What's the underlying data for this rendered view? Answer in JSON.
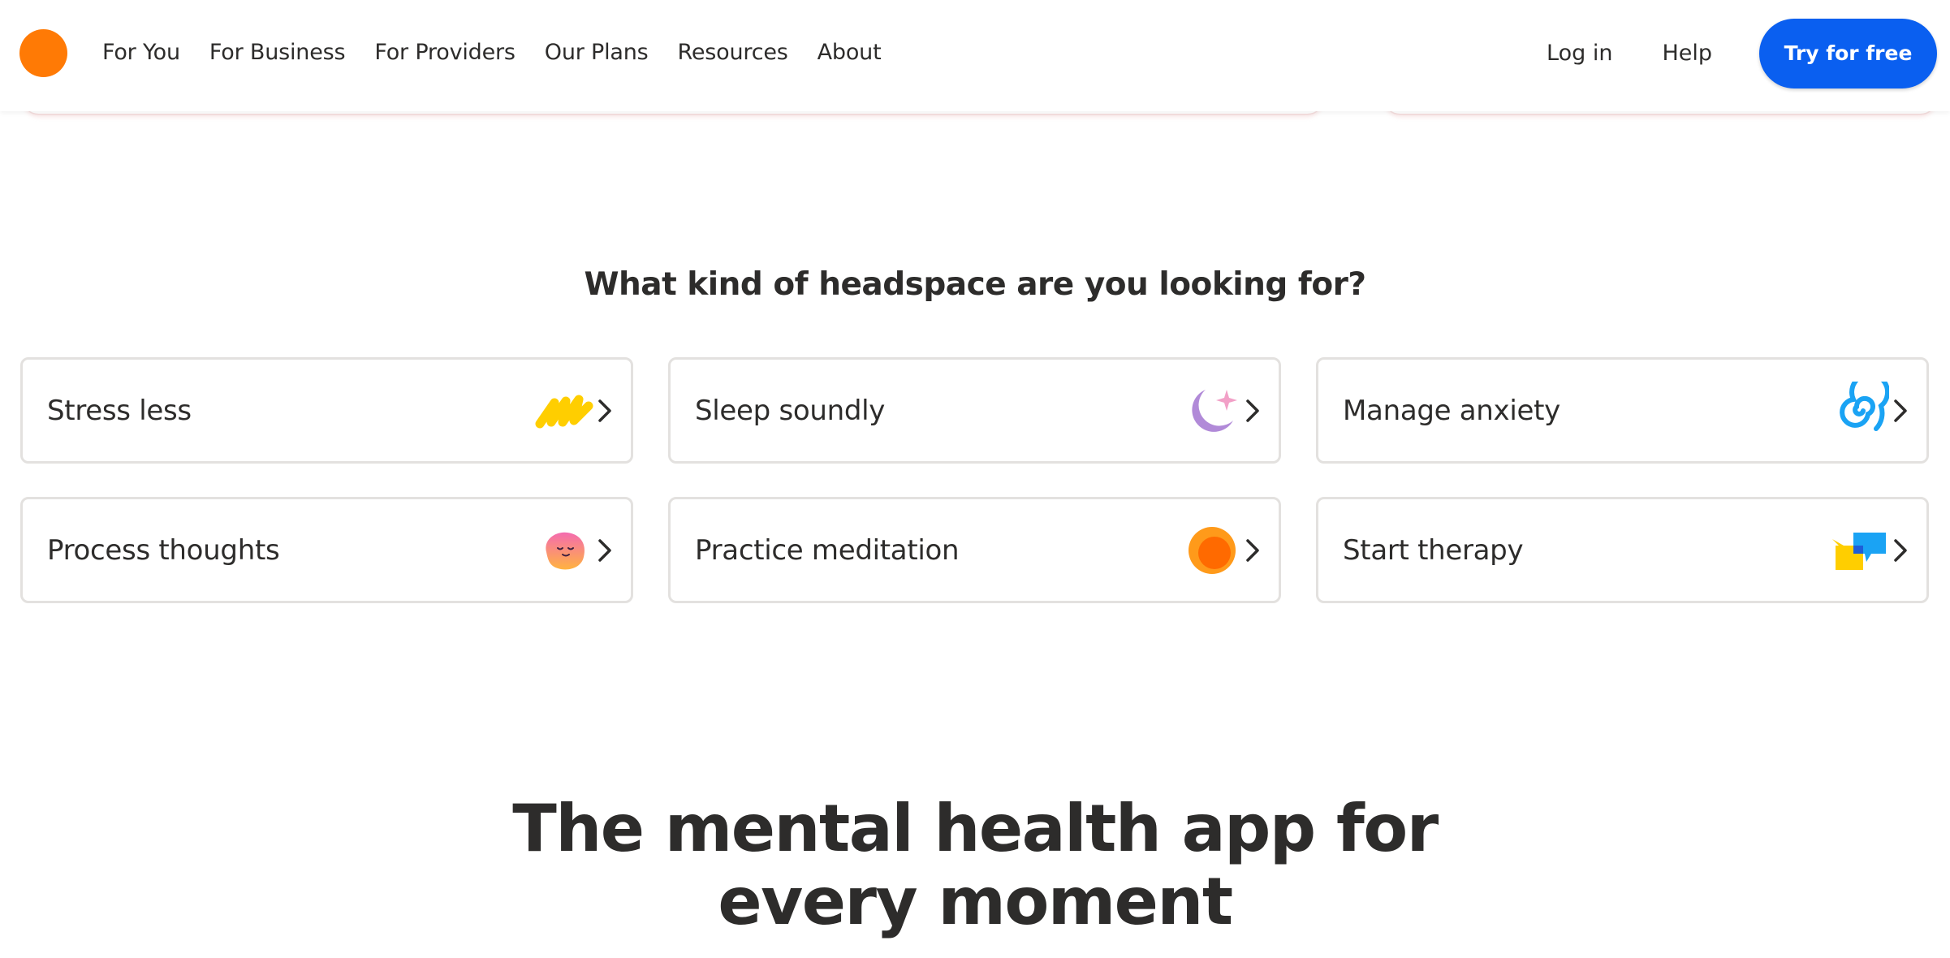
{
  "header": {
    "nav": [
      {
        "label": "For You"
      },
      {
        "label": "For Business"
      },
      {
        "label": "For Providers"
      },
      {
        "label": "Our Plans"
      },
      {
        "label": "Resources"
      },
      {
        "label": "About"
      }
    ],
    "login_label": "Log in",
    "help_label": "Help",
    "cta_label": "Try for free"
  },
  "section": {
    "heading": "What kind of headspace are you looking for?",
    "cards": [
      {
        "label": "Stress less",
        "icon": "yellow-squiggle-icon"
      },
      {
        "label": "Sleep soundly",
        "icon": "moon-star-icon"
      },
      {
        "label": "Manage anxiety",
        "icon": "blue-spiral-icon"
      },
      {
        "label": "Process thoughts",
        "icon": "smiling-blob-icon"
      },
      {
        "label": "Practice meditation",
        "icon": "orange-dot-icon"
      },
      {
        "label": "Start therapy",
        "icon": "speech-bubbles-icon"
      }
    ]
  },
  "hero": {
    "line1": "The mental health app for",
    "line2": "every moment"
  },
  "colors": {
    "brand_orange": "#ff7a05",
    "cta_blue": "#0a5ff0",
    "text_dark": "#2d2c2b",
    "card_border": "#e3e1df"
  }
}
